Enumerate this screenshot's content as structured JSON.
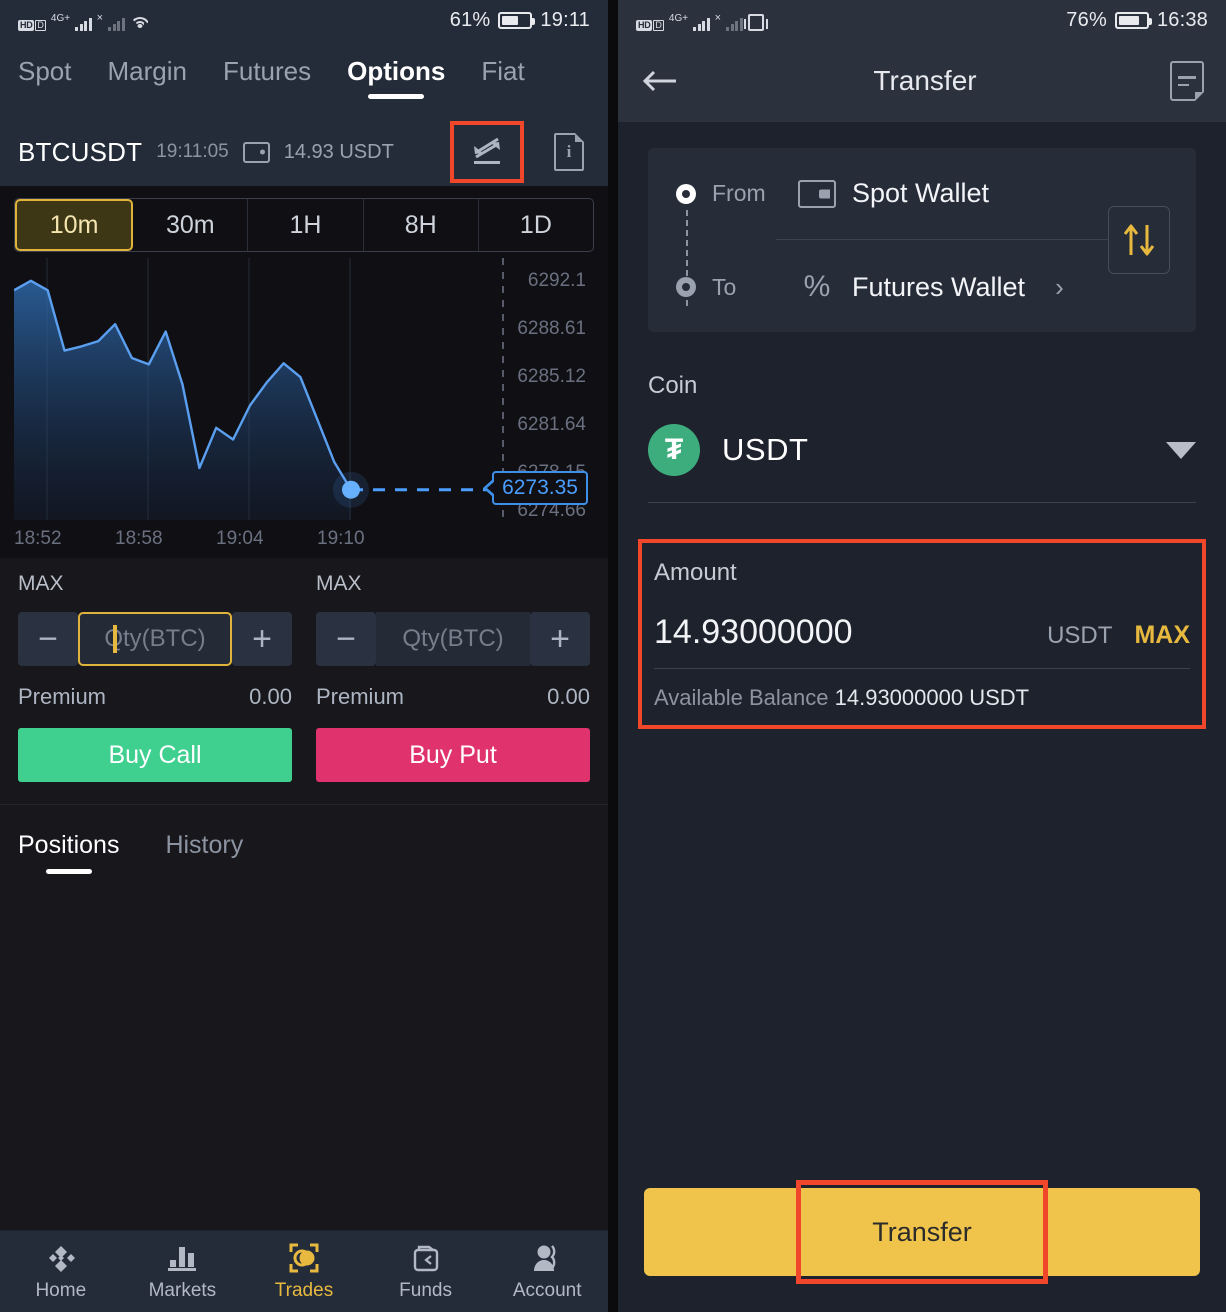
{
  "left": {
    "statusbar": {
      "network_badge": "HD",
      "network_d": "D",
      "net_label": "4G+",
      "battery_percent": "61%",
      "time": "19:11"
    },
    "top_tabs": [
      {
        "label": "Spot",
        "active": false
      },
      {
        "label": "Margin",
        "active": false
      },
      {
        "label": "Futures",
        "active": false
      },
      {
        "label": "Options",
        "active": true
      },
      {
        "label": "Fiat",
        "active": false
      }
    ],
    "symbol_bar": {
      "symbol": "BTCUSDT",
      "time": "19:11:05",
      "balance": "14.93 USDT",
      "swap_icon": "transfer-swap-icon",
      "info_icon": "info-document-icon",
      "info_glyph": "i"
    },
    "periods": [
      {
        "label": "10m",
        "active": true
      },
      {
        "label": "30m",
        "active": false
      },
      {
        "label": "1H",
        "active": false
      },
      {
        "label": "8H",
        "active": false
      },
      {
        "label": "1D",
        "active": false
      }
    ],
    "trade": {
      "call": {
        "max_label": "MAX",
        "minus": "−",
        "plus": "+",
        "qty_placeholder": "Qty(BTC)",
        "qty_value": "",
        "premium_label": "Premium",
        "premium_value": "0.00",
        "button_label": "Buy Call",
        "button_color": "#3fcf8e"
      },
      "put": {
        "max_label": "MAX",
        "minus": "−",
        "plus": "+",
        "qty_placeholder": "Qty(BTC)",
        "qty_value": "",
        "premium_label": "Premium",
        "premium_value": "0.00",
        "button_label": "Buy Put",
        "button_color": "#e0336e"
      }
    },
    "position_tabs": [
      {
        "label": "Positions",
        "active": true
      },
      {
        "label": "History",
        "active": false
      }
    ],
    "bottom_nav": [
      {
        "label": "Home",
        "icon": "binance-diamond-icon",
        "active": false
      },
      {
        "label": "Markets",
        "icon": "bar-chart-icon",
        "active": false
      },
      {
        "label": "Trades",
        "icon": "trades-circle-icon",
        "active": true
      },
      {
        "label": "Funds",
        "icon": "wallet-funds-icon",
        "active": false
      },
      {
        "label": "Account",
        "icon": "person-account-icon",
        "active": false
      }
    ]
  },
  "right": {
    "statusbar": {
      "network_badge": "HD",
      "network_d": "D",
      "net_label": "4G+",
      "battery_percent": "76%",
      "time": "16:38"
    },
    "header": {
      "back_icon": "back-arrow-icon",
      "title": "Transfer",
      "note_icon": "transfer-record-icon"
    },
    "wallet_card": {
      "from_label": "From",
      "from_wallet": "Spot Wallet",
      "from_icon": "spot-wallet-icon",
      "to_label": "To",
      "to_wallet": "Futures Wallet",
      "to_icon": "percent-icon",
      "chevron": "›",
      "swap_icon": "swap-direction-icon"
    },
    "coin": {
      "section_label": "Coin",
      "symbol": "USDT",
      "glyph": "₮",
      "color": "#3ead7e",
      "dropdown_icon": "chevron-down-icon"
    },
    "amount": {
      "section_label": "Amount",
      "value": "14.93000000",
      "unit": "USDT",
      "max_label": "MAX",
      "available_label": "Available Balance",
      "available_value": "14.93000000",
      "available_unit": "USDT",
      "highlight_color": "#f0462a"
    },
    "transfer_button": {
      "label": "Transfer",
      "color": "#f0c44a",
      "highlight_color": "#f0462a"
    }
  },
  "chart_data": {
    "type": "area",
    "title": "BTCUSDT price",
    "xlabel": "",
    "ylabel": "",
    "grid": true,
    "legend": null,
    "x_ticks": [
      "18:52",
      "18:58",
      "19:04",
      "19:10"
    ],
    "y_ticks": [
      6292.1,
      6288.61,
      6285.12,
      6281.64,
      6278.15,
      6274.66
    ],
    "ylim": [
      6272.0,
      6294.5
    ],
    "current_price": "6273.35",
    "current_price_color": "#4a9eff",
    "line_color": "#5b9ff0",
    "x": [
      0,
      1,
      2,
      3,
      4,
      5,
      6,
      7,
      8,
      9,
      10,
      11,
      12,
      13,
      14,
      15,
      16,
      17,
      18,
      19,
      20
    ],
    "values": [
      6292.2,
      6293.1,
      6292.2,
      6286.5,
      6286.9,
      6287.4,
      6289.0,
      6285.8,
      6285.2,
      6288.3,
      6283.3,
      6275.4,
      6279.2,
      6278.1,
      6281.3,
      6283.5,
      6285.3,
      6284.0,
      6280.0,
      6276.0,
      6273.35
    ]
  }
}
